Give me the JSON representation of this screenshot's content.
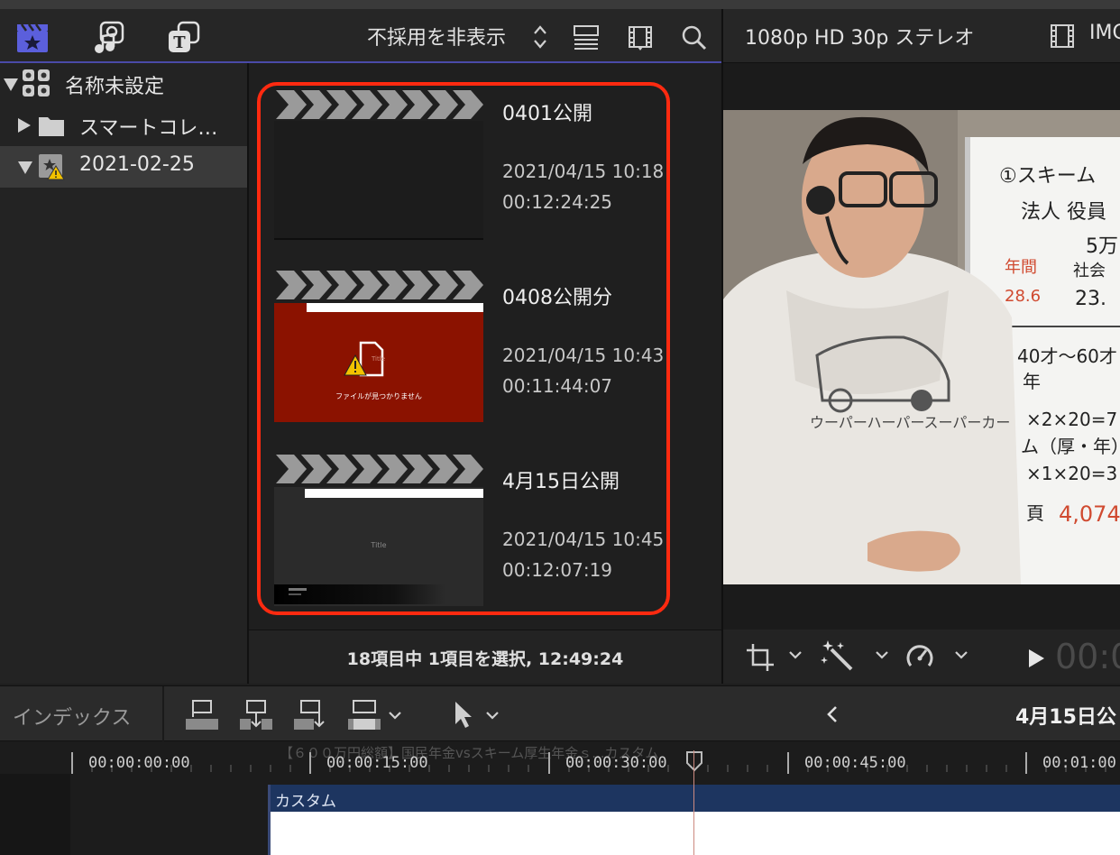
{
  "toolbar": {
    "icons": [
      "clapper-star-icon",
      "photos-music-icon",
      "titles-icon",
      "list-view-icon",
      "filmstrip-icon",
      "search-icon"
    ],
    "filter_label": "不採用を非表示"
  },
  "sidebar": {
    "library_name": "名称未設定",
    "items": [
      {
        "label": "スマートコレ…",
        "icon": "folder-icon"
      },
      {
        "label": "2021-02-25",
        "icon": "event-warning-icon"
      }
    ]
  },
  "browser": {
    "clips": [
      {
        "name": "0401公開",
        "date": "2021/04/15 10:18",
        "duration": "00:12:24:25",
        "thumb": "black"
      },
      {
        "name": "0408公開分",
        "date": "2021/04/15 10:43",
        "duration": "00:11:44:07",
        "thumb": "missing",
        "thumb_title": "Title",
        "missing_text": "ファイルが見つかりません"
      },
      {
        "name": "4月15日公開",
        "date": "2021/04/15 10:45",
        "duration": "00:12:07:19",
        "thumb": "title",
        "thumb_title": "Title"
      }
    ],
    "status": "18項目中 1項目を選択, 12:49:24"
  },
  "viewer": {
    "format": "1080p HD 30p ステレオ",
    "clip_name": "IMG",
    "timecode": "00:0",
    "whiteboard": [
      "①スキーム",
      "法人 役員",
      "5万",
      "年間",
      "28.6",
      "社会",
      "23.",
      "40才〜60才",
      "年",
      "×2×20=7",
      "ム（厚・年）",
      "×1×20=3",
      "頁",
      "4,074"
    ],
    "shirt_text": "ウーパーハーパースーパーカー"
  },
  "timeline": {
    "index_label": "インデックス",
    "project_title": "4月15日公",
    "ruler": [
      "00:00:00:00",
      "00:00:15:00",
      "00:00:30:00",
      "00:00:45:00",
      "00:01:00"
    ],
    "ghost_title": "【６００万円総額】国民年金vsスキーム厚生年金ｓ...カスタム",
    "clip_label": "カスタム"
  },
  "colors": {
    "highlight": "#ff2a10",
    "accent": "#4a4aa8",
    "missing_red": "#8b1200"
  }
}
